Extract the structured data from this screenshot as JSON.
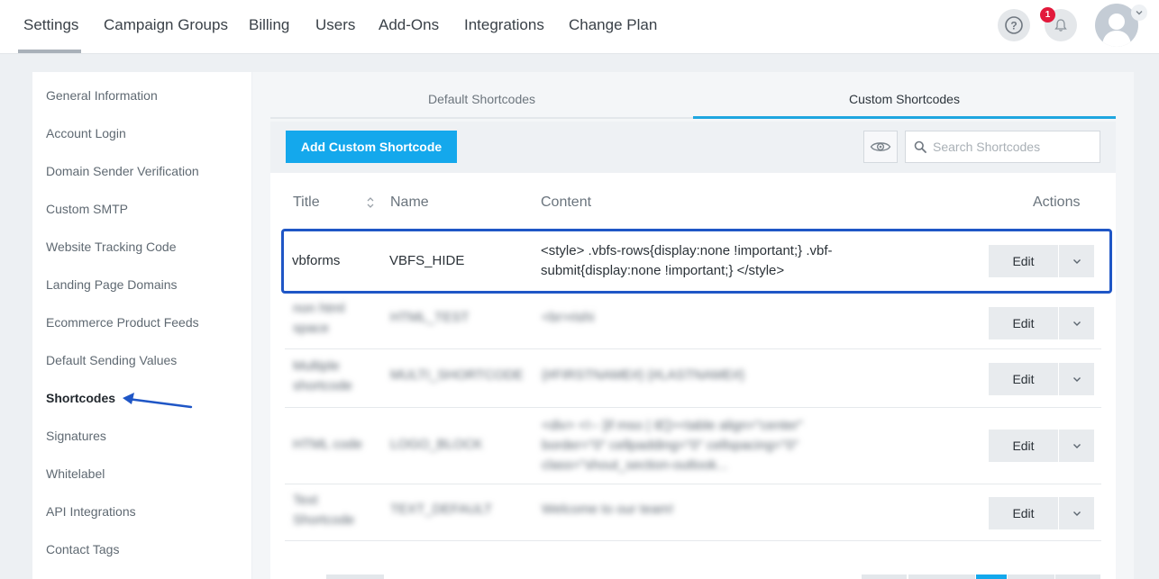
{
  "topnav": {
    "items": [
      "Settings",
      "Campaign Groups",
      "Billing",
      "Users",
      "Add-Ons",
      "Integrations",
      "Change Plan"
    ],
    "notification_count": "1",
    "help_glyph": "?"
  },
  "sidebar": {
    "items": [
      "General Information",
      "Account Login",
      "Domain Sender Verification",
      "Custom SMTP",
      "Website Tracking Code",
      "Landing Page Domains",
      "Ecommerce Product Feeds",
      "Default Sending Values",
      "Shortcodes",
      "Signatures",
      "Whitelabel",
      "API Integrations",
      "Contact Tags"
    ],
    "active": "Shortcodes"
  },
  "tabs": {
    "default": "Default Shortcodes",
    "custom": "Custom Shortcodes"
  },
  "toolbar": {
    "add_label": "Add Custom Shortcode",
    "search_placeholder": "Search Shortcodes"
  },
  "table": {
    "headers": {
      "title": "Title",
      "name": "Name",
      "content": "Content",
      "actions": "Actions"
    },
    "rows": [
      {
        "title": "vbforms",
        "name": "VBFS_HIDE",
        "content_line1": "<style> .vbfs-rows{display:none !important;} .vbf-",
        "content_line2": "submit{display:none !important;} </style>",
        "edit": "Edit"
      },
      {
        "title_line1": "non html",
        "title_line2": "space",
        "name": "HTML_TEST",
        "content_line1": "<br>rishi",
        "content_line2": "",
        "edit": "Edit"
      },
      {
        "title_line1": "Multiple",
        "title_line2": "shortcode",
        "name": "MULTI_SHORTCODE",
        "content_line1": "{#FIRSTNAME#} {#LASTNAME#}",
        "content_line2": "",
        "edit": "Edit"
      },
      {
        "title_line1": "HTML code",
        "title_line2": "",
        "name": "LOGO_BLOCK",
        "content_line1": "<div> <!-- [if mso | IE]><table align=\"center\"",
        "content_line2": "border=\"0\" cellpadding=\"0\" cellspacing=\"0\"",
        "content_line3": "class=\"shout_section-outlook...",
        "edit": "Edit"
      },
      {
        "title_line1": "Text",
        "title_line2": "Shortcode",
        "name": "TEXT_DEFAULT",
        "content_line1": "Welcome to our team!",
        "content_line2": "",
        "edit": "Edit"
      }
    ]
  },
  "colors": {
    "accent": "#14a8ec",
    "tab_underline": "#1fa6e0",
    "highlight_border": "#1f56c6",
    "annotation_arrow": "#1f56c6",
    "badge": "#e2193b"
  },
  "icons": {
    "help": "question-circle-icon",
    "bell": "bell-icon",
    "avatar": "user-avatar",
    "eye": "eye-icon",
    "search": "search-icon",
    "sort": "sort-icon",
    "caret": "chevron-down-icon",
    "arrow": "annotation-arrow"
  }
}
